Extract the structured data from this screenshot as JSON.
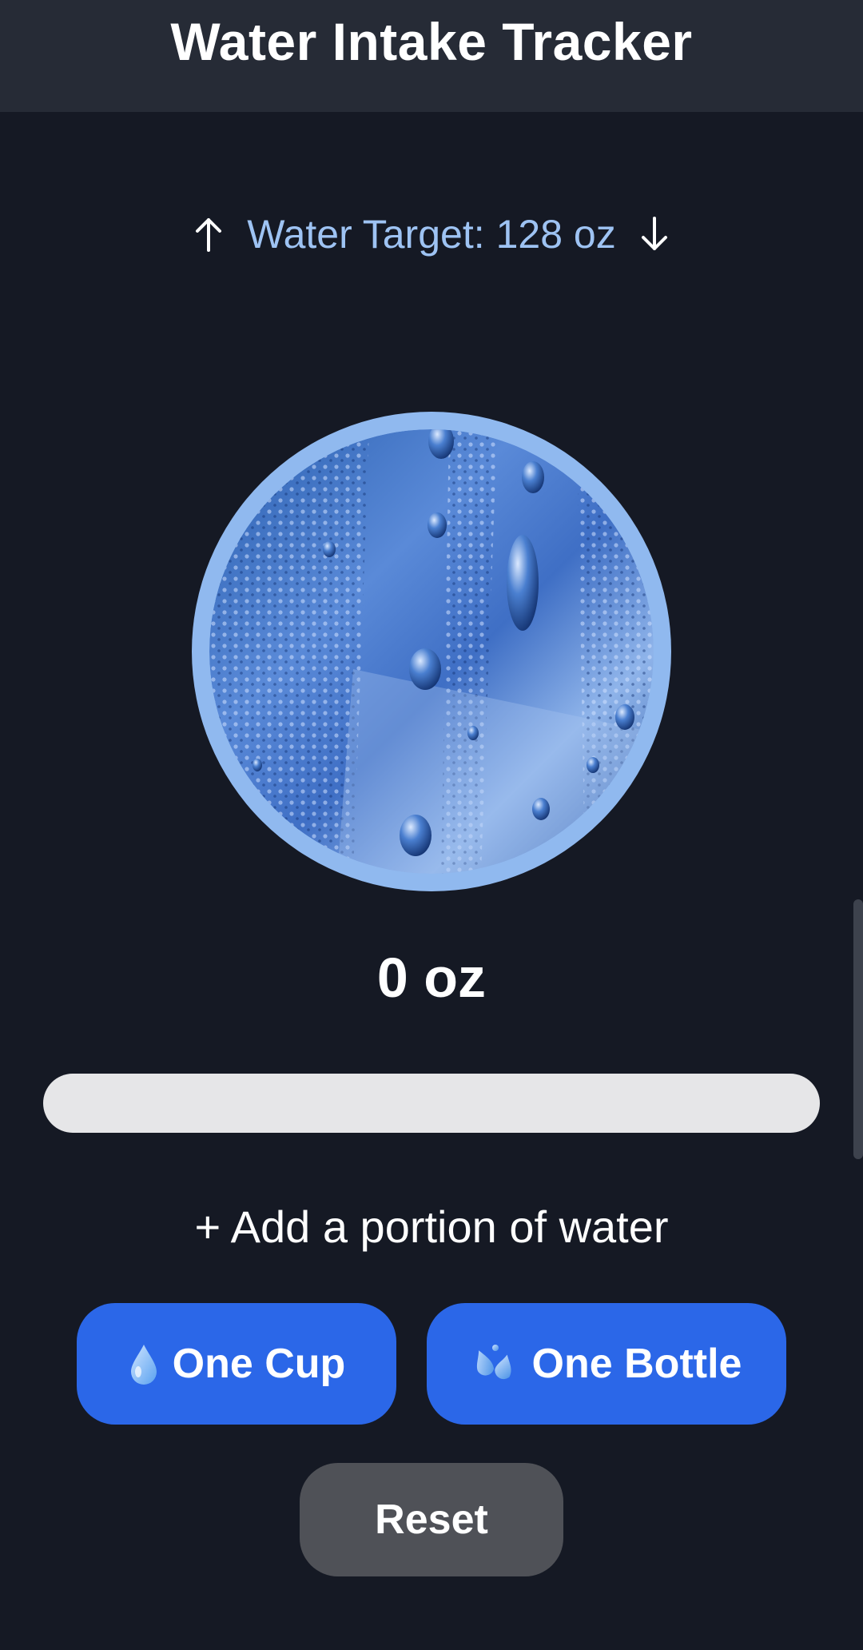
{
  "header": {
    "title": "Water Intake Tracker"
  },
  "target": {
    "label": "Water Target:",
    "value": "128 oz",
    "increase_icon": "arrow-up-icon",
    "decrease_icon": "arrow-down-icon"
  },
  "tracker": {
    "amount_text": "0 oz",
    "progress_fraction": 0
  },
  "portion": {
    "add_label": "+ Add a portion of water",
    "cup_label": "One Cup",
    "cup_icon": "water-drop-icon",
    "bottle_label": "One Bottle",
    "bottle_icon": "splash-drops-icon",
    "reset_label": "Reset"
  },
  "colors": {
    "background": "#151924",
    "header": "#262b36",
    "accent_blue": "#2b67e8",
    "target_text": "#9ec3f3",
    "ring": "#90b9ef",
    "progress_track": "#e6e6e8",
    "reset_button": "#4f5157"
  }
}
